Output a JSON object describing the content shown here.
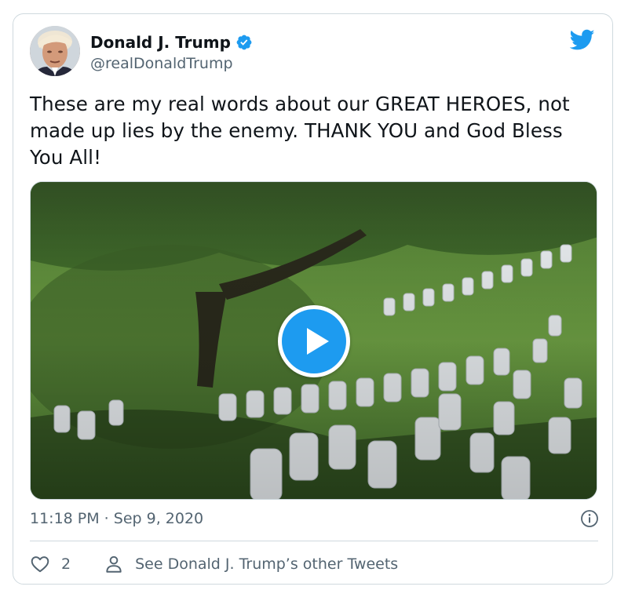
{
  "tweet": {
    "author": {
      "display_name": "Donald J. Trump",
      "handle": "@realDonaldTrump",
      "verified": true,
      "avatar": "profile-photo"
    },
    "text": "These are my real words about our GREAT HEROES, not made up lies by the enemy. THANK YOU and God Bless You All!",
    "media": {
      "type": "video",
      "thumbnail": "cemetery-with-trees-and-headstones",
      "play_icon": "play-icon"
    },
    "timestamp": "11:18 PM · Sep 9, 2020",
    "like_count": "2",
    "other_tweets_label": "See Donald J. Trump’s other Tweets"
  },
  "icons": {
    "brand": "twitter-bird-icon",
    "verified": "verified-badge-icon",
    "info": "info-icon",
    "like": "heart-icon",
    "profile": "person-icon"
  },
  "colors": {
    "accent": "#1d9bf0",
    "text_primary": "#0f1419",
    "text_secondary": "#536471",
    "border": "#cfd9de"
  }
}
